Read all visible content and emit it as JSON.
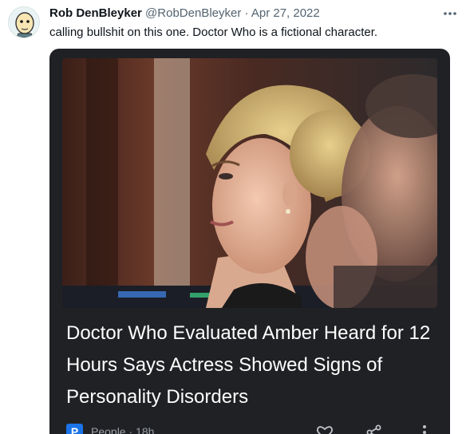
{
  "tweet": {
    "author_name": "Rob DenBleyker",
    "author_handle": "@RobDenBleyker",
    "separator": "·",
    "date": "Apr 27, 2022",
    "text": "calling bullshit on this one. Doctor Who is a fictional character."
  },
  "card": {
    "headline": "Doctor Who Evaluated Amber Heard for 12 Hours Says Actress Showed Signs of Personality Disorders",
    "source_badge_letter": "P",
    "source_text": "People · 18h"
  },
  "icons": {
    "avatar": "cartoon-avatar",
    "more": "more-icon",
    "like": "heart-icon",
    "share": "share-icon",
    "menu": "vertical-dots-icon"
  },
  "colors": {
    "card_background": "#202124",
    "source_badge": "#1a73e8",
    "secondary_text": "#536471"
  }
}
